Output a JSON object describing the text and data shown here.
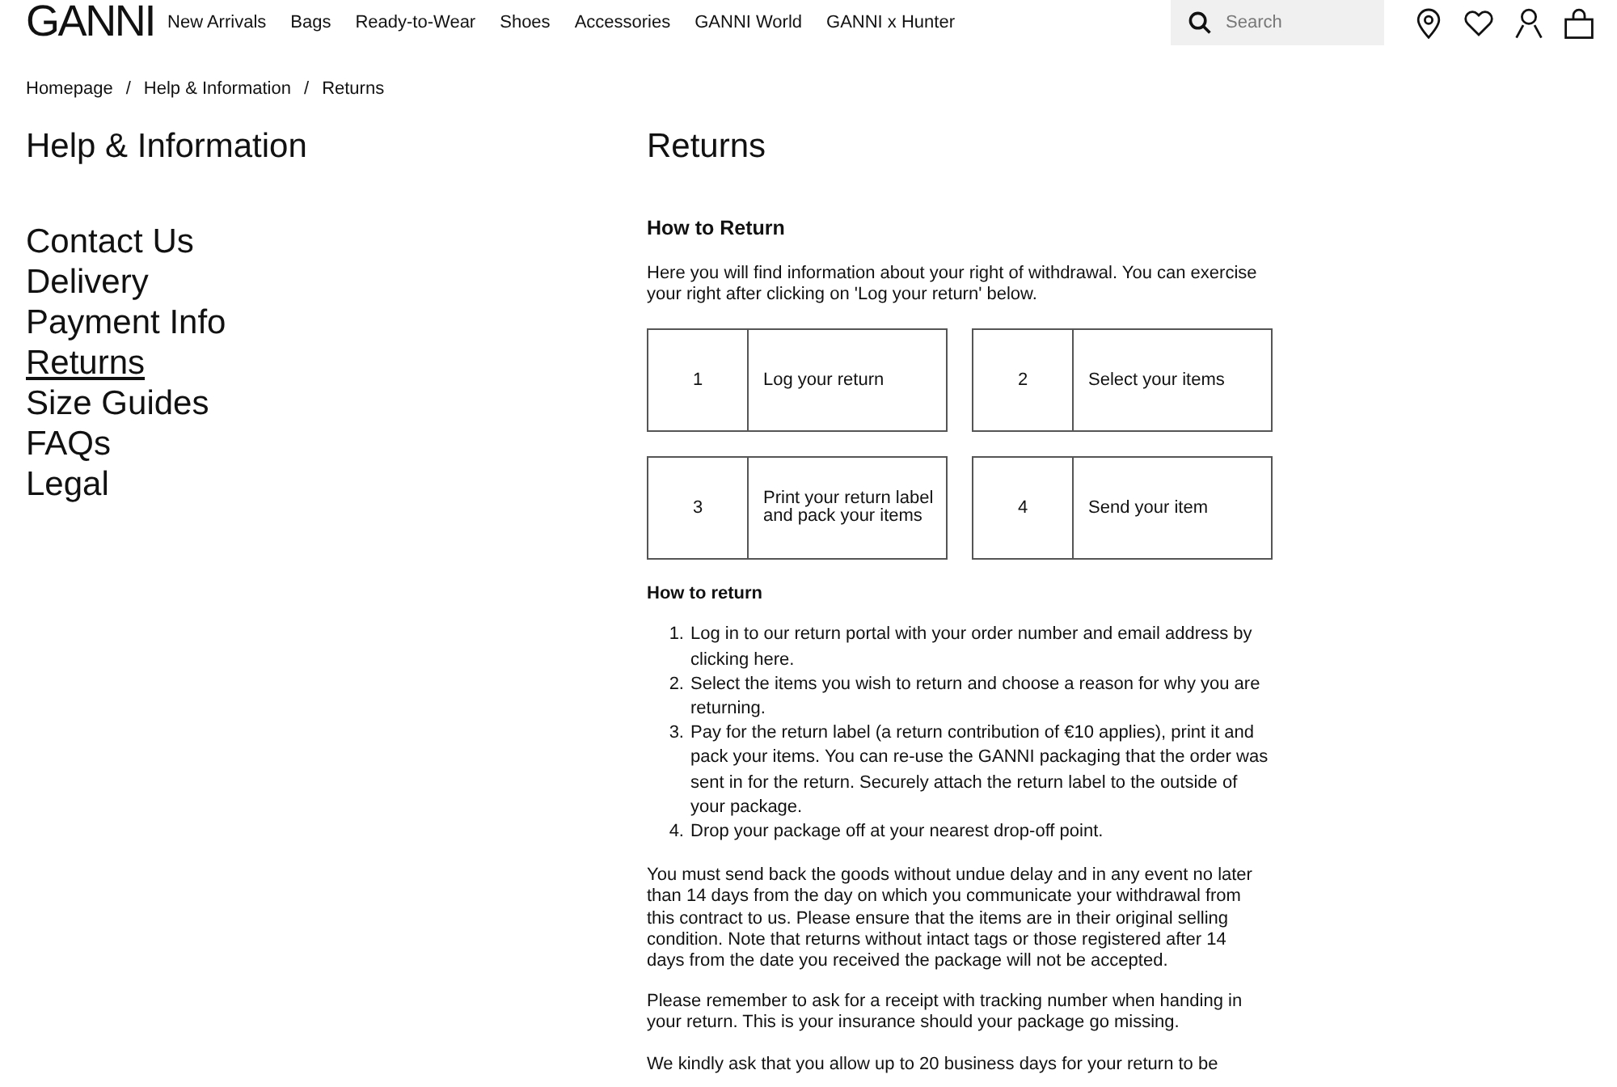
{
  "header": {
    "logo": "GANNI",
    "nav": [
      "New Arrivals",
      "Bags",
      "Ready-to-Wear",
      "Shoes",
      "Accessories",
      "GANNI World",
      "GANNI x Hunter"
    ],
    "search": {
      "placeholder": "Search"
    }
  },
  "breadcrumb": {
    "items": [
      "Homepage",
      "Help & Information",
      "Returns"
    ],
    "separators": [
      "/",
      "/"
    ]
  },
  "sidebar": {
    "title": "Help & Information",
    "items": [
      {
        "label": "Contact Us",
        "selected": false
      },
      {
        "label": "Delivery",
        "selected": false
      },
      {
        "label": "Payment Info",
        "selected": false
      },
      {
        "label": "Returns",
        "selected": true
      },
      {
        "label": "Size Guides",
        "selected": false
      },
      {
        "label": "FAQs",
        "selected": false
      },
      {
        "label": "Legal",
        "selected": false
      }
    ]
  },
  "content": {
    "title": "Returns",
    "section_title": "How to Return",
    "intro": "Here you will find information about your right of withdrawal. You can exercise your right after clicking on 'Log your return' below.",
    "steps": [
      {
        "number": "1",
        "label": "Log your return"
      },
      {
        "number": "2",
        "label": "Select your items"
      },
      {
        "number": "3",
        "label": "Print your return label and pack your items"
      },
      {
        "number": "4",
        "label": "Send your item"
      }
    ],
    "subheading": "How to return",
    "list": [
      {
        "number": "1.",
        "text": "Log in to our return portal with your order number and email address by clicking",
        "link": "here."
      },
      {
        "number": "2.",
        "text": "Select the items you wish to return and choose a reason for why you are returning."
      },
      {
        "number": "3.",
        "text": "Pay for the return label (a return contribution of €10 applies), print it and pack your items. You can re-use the GANNI packaging that the order was sent in for the return. Securely attach the return label to the outside of your package."
      },
      {
        "number": "4.",
        "text": "Drop your package off at your nearest drop-off point."
      }
    ],
    "paragraphs": [
      "You must send back the goods without undue delay and in any event no later than 14 days from the day on which you communicate your withdrawal from this contract to us. Please ensure that the items are in their original selling condition. Note that returns without intact tags or those registered after 14 days from the date you received the package will not be accepted.",
      "Please remember to ask for a receipt with tracking number when handing in your return. This is your insurance should your package go missing.",
      "We kindly ask that you allow up to 20 business days for your return to be"
    ]
  }
}
